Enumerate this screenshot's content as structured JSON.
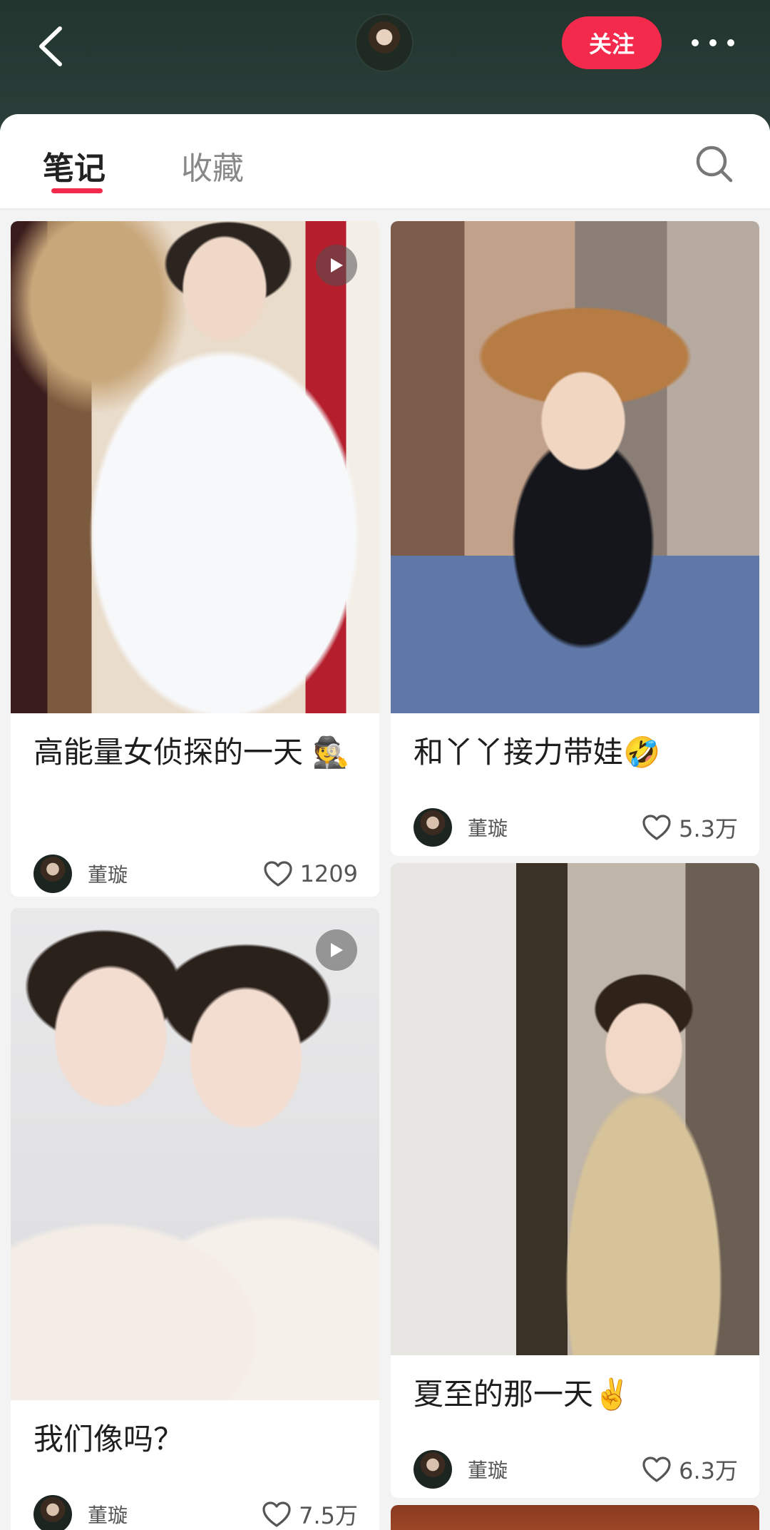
{
  "header": {
    "follow_label": "关注"
  },
  "tabs": [
    {
      "label": "笔记"
    },
    {
      "label": "收藏"
    }
  ],
  "notes": [
    {
      "title": "高能量女侦探的一天 🕵️",
      "author": "董璇",
      "likes": "1209",
      "video": true
    },
    {
      "title": "和丫丫接力带娃🤣",
      "author": "董璇",
      "likes": "5.3万",
      "video": false
    },
    {
      "title": "我们像吗？",
      "author": "董璇",
      "likes": "7.5万",
      "video": true
    },
    {
      "title": "夏至的那一天✌️",
      "author": "董璇",
      "likes": "6.3万",
      "video": false
    }
  ],
  "colors": {
    "accent": "#f32a4c",
    "header_bg": "#2a3d38"
  },
  "icons": [
    "back-arrow-icon",
    "more-dots-icon",
    "search-icon",
    "play-icon",
    "heart-icon"
  ]
}
